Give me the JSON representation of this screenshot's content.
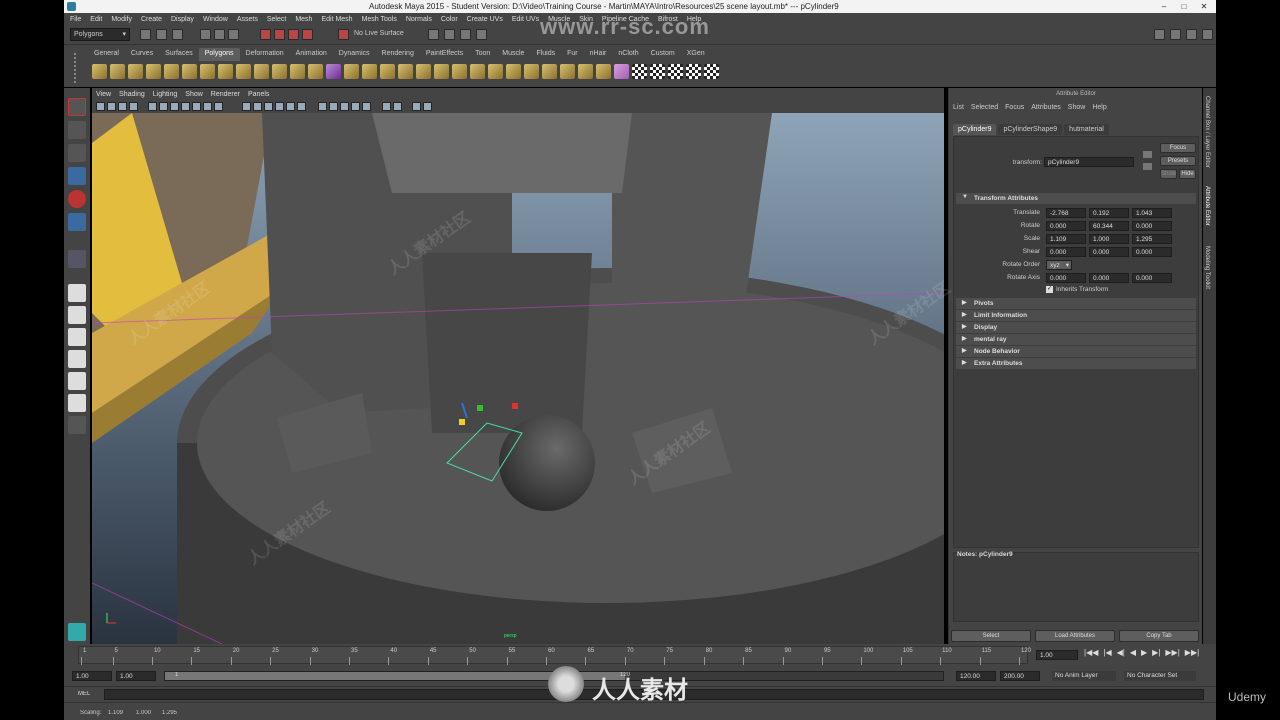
{
  "titlebar": {
    "title": "Autodesk Maya 2015 - Student Version: D:\\Video\\Training Course - Martin\\MAYA\\Intro\\Resources\\25 scene layout.mb*  ---  pCylinder9",
    "min": "–",
    "max": "□",
    "close": "✕"
  },
  "menubar": {
    "items": [
      "File",
      "Edit",
      "Modify",
      "Create",
      "Display",
      "Window",
      "Assets",
      "Select",
      "Mesh",
      "Edit Mesh",
      "Mesh Tools",
      "Normals",
      "Color",
      "Create UVs",
      "Edit UVs",
      "Muscle",
      "Skin",
      "Pipeline Cache",
      "Bifrost",
      "Help"
    ]
  },
  "statusline": {
    "mode": "Polygons",
    "live_surface": "No Live Surface"
  },
  "watermark": {
    "site": "www.rr-sc.com",
    "brand": "人人素材",
    "udemy": "Udemy",
    "cjk": "人人素材社区"
  },
  "shelf": {
    "tabs": [
      "General",
      "Curves",
      "Surfaces",
      "Polygons",
      "Deformation",
      "Animation",
      "Dynamics",
      "Rendering",
      "PaintEffects",
      "Toon",
      "Muscle",
      "Fluids",
      "Fur",
      "nHair",
      "nCloth",
      "Custom",
      "XGen"
    ],
    "active": "Polygons"
  },
  "viewport": {
    "menu": [
      "View",
      "Shading",
      "Lighting",
      "Show",
      "Renderer",
      "Panels"
    ],
    "persp_label": "persp"
  },
  "attribute_editor": {
    "header": "Attribute Editor",
    "menu": [
      "List",
      "Selected",
      "Focus",
      "Attributes",
      "Show",
      "Help"
    ],
    "tabs": [
      "pCylinder9",
      "pCylinderShape9",
      "hutmaterial"
    ],
    "transform_label": "transform:",
    "transform_value": "pCylinder9",
    "focus": "Focus",
    "presets": "Presets",
    "show": "Show",
    "hide": "Hide",
    "transform_section": "Transform Attributes",
    "rows": [
      {
        "label": "Translate",
        "values": [
          "-2.768",
          "0.192",
          "1.043"
        ]
      },
      {
        "label": "Rotate",
        "values": [
          "0.000",
          "60.344",
          "0.000"
        ]
      },
      {
        "label": "Scale",
        "values": [
          "1.109",
          "1.000",
          "1.295"
        ]
      },
      {
        "label": "Shear",
        "values": [
          "0.000",
          "0.000",
          "0.000"
        ]
      }
    ],
    "rotate_order_label": "Rotate Order",
    "rotate_order": "xyz",
    "rotate_axis_label": "Rotate Axis",
    "rotate_axis": [
      "0.000",
      "0.000",
      "0.000"
    ],
    "inherits": "Inherits Transform",
    "sections": [
      "Pivots",
      "Limit Information",
      "Display",
      "mental ray",
      "Node Behavior",
      "Extra Attributes"
    ],
    "notes_label": "Notes: pCylinder9",
    "buttons": {
      "select": "Select",
      "load": "Load Attributes",
      "copy": "Copy Tab"
    }
  },
  "side_tabs": [
    "Channel Box / Layer Editor",
    "Attribute Editor",
    "Modeling Toolkit"
  ],
  "timeslider": {
    "ticks": [
      "1",
      "5",
      "10",
      "15",
      "20",
      "25",
      "30",
      "35",
      "40",
      "45",
      "50",
      "55",
      "60",
      "65",
      "70",
      "75",
      "80",
      "85",
      "90",
      "95",
      "100",
      "105",
      "110",
      "115",
      "120"
    ],
    "current": "1.00",
    "playback": [
      "|◀◀",
      "|◀",
      "◀|",
      "◀",
      "▶",
      "▶|",
      "▶▶|",
      "▶▶|"
    ]
  },
  "rangebar": {
    "start": "1.00",
    "start2": "1.00",
    "range_start": "1",
    "range_end": "120",
    "end": "120.00",
    "end2": "200.00",
    "anim_layer": "No Anim Layer",
    "char_set": "No Character Set"
  },
  "cmdline": {
    "label": "MEL"
  },
  "helpline": {
    "label": "Scaling:",
    "values": [
      "1.109",
      "1.000",
      "1.295"
    ]
  },
  "colors": {
    "bg": "#444444",
    "viewport_top": "#8fa4b8",
    "viewport_bottom": "#2a3340",
    "accent": "#5285a6",
    "selection": "#45e0a0",
    "yellow_wall": "#e3bd3d"
  }
}
